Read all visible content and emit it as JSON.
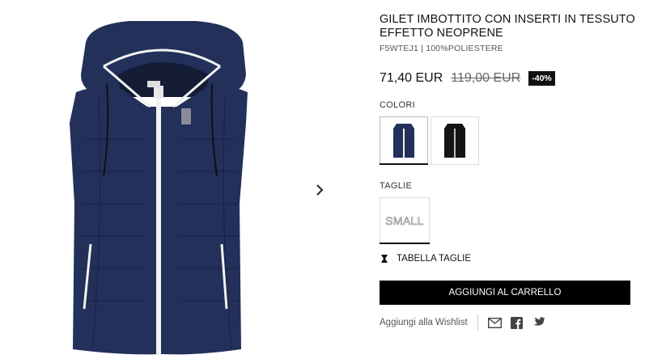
{
  "product": {
    "title": "GILET IMBOTTITO CON INSERTI IN TESSUTO EFFETTO NEOPRENE",
    "sku": "F5WTEJ1 | 100%POLIESTERE",
    "price": "71,40 EUR",
    "old_price": "119,00 EUR",
    "discount": "-40%"
  },
  "colors": {
    "label": "COLORI",
    "options": [
      {
        "name": "navy",
        "hex": "#1f2b52",
        "selected": true
      },
      {
        "name": "black",
        "hex": "#151515",
        "selected": false
      }
    ]
  },
  "sizes": {
    "label": "TAGLIE",
    "options": [
      "SMALL"
    ],
    "guide_label": "TABELLA TAGLIE"
  },
  "cart": {
    "label": "AGGIUNGI AL CARRELLO"
  },
  "wishlist": {
    "label": "Aggiungi alla Wishlist"
  },
  "social": [
    "mail-icon",
    "facebook-icon",
    "twitter-icon"
  ],
  "theme": {
    "accent": "#000000",
    "vest_navy": "#22305a",
    "zipper": "#f2f2f2"
  }
}
